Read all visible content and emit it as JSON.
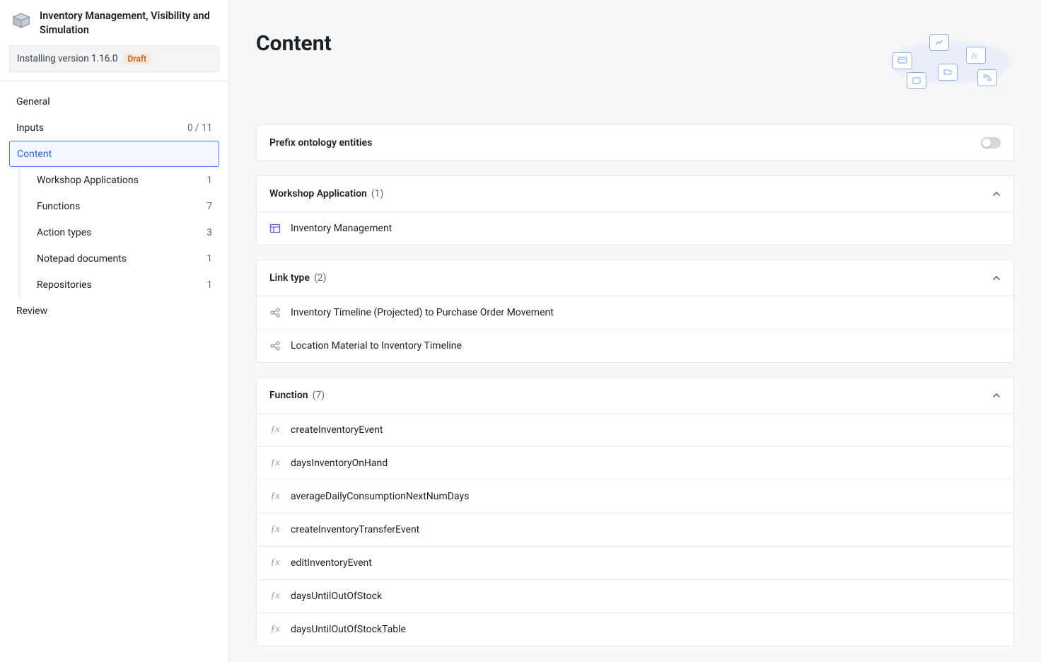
{
  "sidebar": {
    "title": "Inventory Management, Visibility and Simulation",
    "version_label": "Installing version 1.16.0",
    "draft_label": "Draft",
    "nav": {
      "general": "General",
      "inputs": {
        "label": "Inputs",
        "count": "0 / 11"
      },
      "content": {
        "label": "Content"
      },
      "review": "Review"
    },
    "content_children": [
      {
        "label": "Workshop Applications",
        "count": "1"
      },
      {
        "label": "Functions",
        "count": "7"
      },
      {
        "label": "Action types",
        "count": "3"
      },
      {
        "label": "Notepad documents",
        "count": "1"
      },
      {
        "label": "Repositories",
        "count": "1"
      }
    ]
  },
  "main": {
    "heading": "Content",
    "prefix_card": {
      "label": "Prefix ontology entities"
    },
    "sections": {
      "workshop": {
        "title": "Workshop Application",
        "count": "(1)",
        "items": [
          {
            "label": "Inventory Management"
          }
        ]
      },
      "linktype": {
        "title": "Link type",
        "count": "(2)",
        "items": [
          {
            "label": "Inventory Timeline (Projected) to Purchase Order Movement"
          },
          {
            "label": "Location Material to Inventory Timeline"
          }
        ]
      },
      "function": {
        "title": "Function",
        "count": "(7)",
        "items": [
          {
            "label": "createInventoryEvent"
          },
          {
            "label": "daysInventoryOnHand"
          },
          {
            "label": "averageDailyConsumptionNextNumDays"
          },
          {
            "label": "createInventoryTransferEvent"
          },
          {
            "label": "editInventoryEvent"
          },
          {
            "label": "daysUntilOutOfStock"
          },
          {
            "label": "daysUntilOutOfStockTable"
          }
        ]
      }
    }
  }
}
